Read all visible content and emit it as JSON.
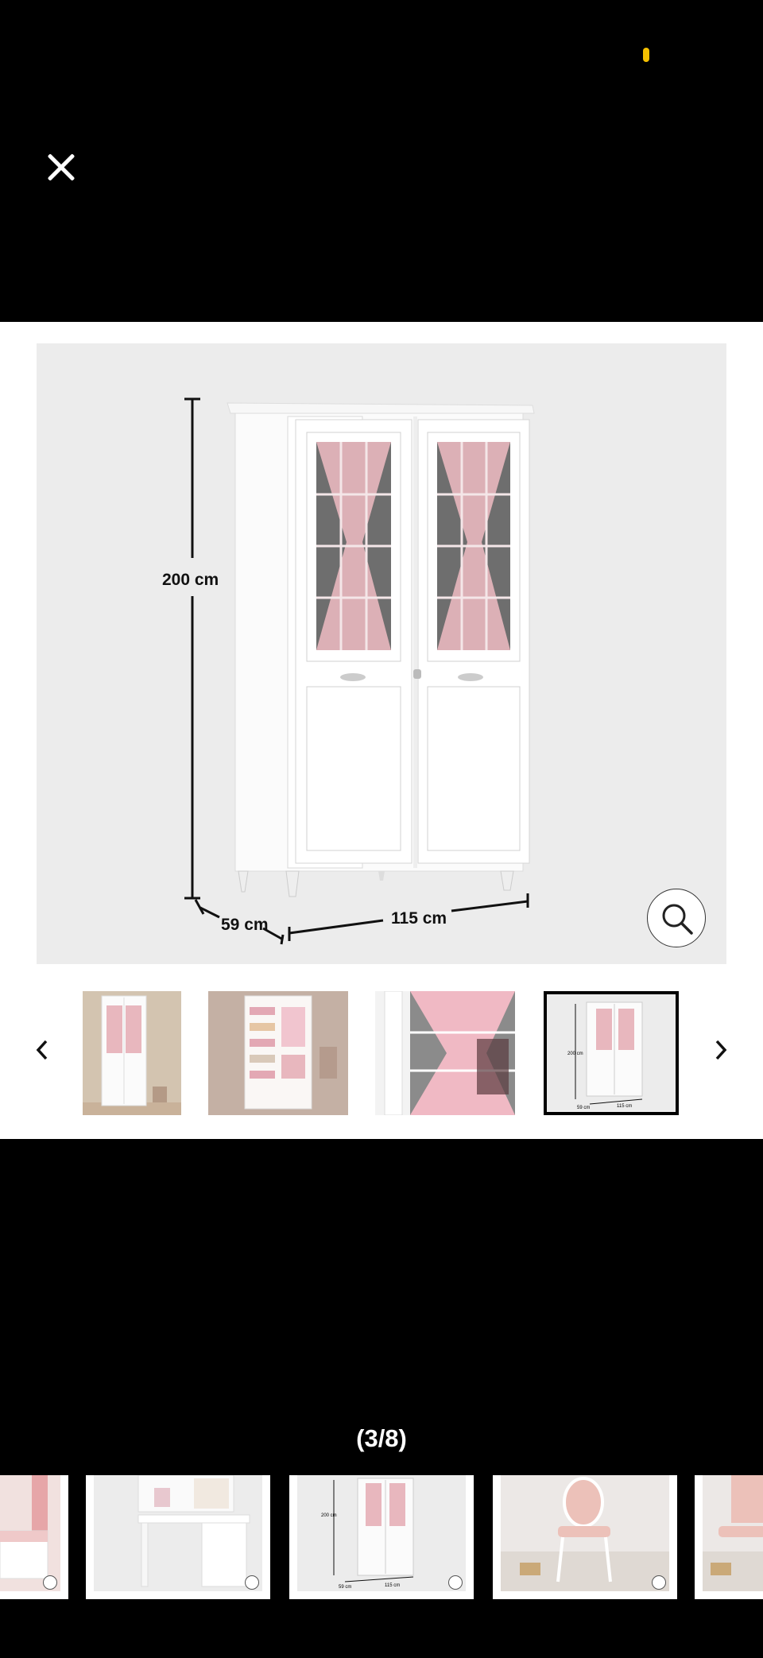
{
  "viewer": {
    "close_label": "close",
    "counter": "(3/8)",
    "main_image": {
      "height_label": "200 cm",
      "depth_label": "59 cm",
      "width_label": "115 cm"
    },
    "icons": {
      "close": "close-icon",
      "zoom": "magnifier-icon",
      "prev": "chevron-left-icon",
      "next": "chevron-right-icon"
    },
    "colors": {
      "status_dot": "#f5c000",
      "background": "#000000",
      "image_bg": "#ececec",
      "curtain": "#e8b7be"
    }
  },
  "thumbnail_strip": {
    "items": [
      {
        "name": "wardrobe-room-view",
        "selected": false
      },
      {
        "name": "wardrobe-open-interior",
        "selected": false
      },
      {
        "name": "wardrobe-curtain-detail",
        "selected": false
      },
      {
        "name": "wardrobe-dimensions",
        "selected": true
      }
    ],
    "mini_labels": {
      "height": "200 cm",
      "depth": "59 cm",
      "width": "115 cm"
    }
  },
  "bottom_strip": {
    "items": [
      {
        "name": "bed-partial"
      },
      {
        "name": "desk-with-hutch"
      },
      {
        "name": "wardrobe-dimensions"
      },
      {
        "name": "pink-chair"
      },
      {
        "name": "pink-chair-partial"
      }
    ],
    "mini_labels": {
      "height": "200 cm",
      "depth": "59 cm",
      "width": "115 cm"
    }
  }
}
